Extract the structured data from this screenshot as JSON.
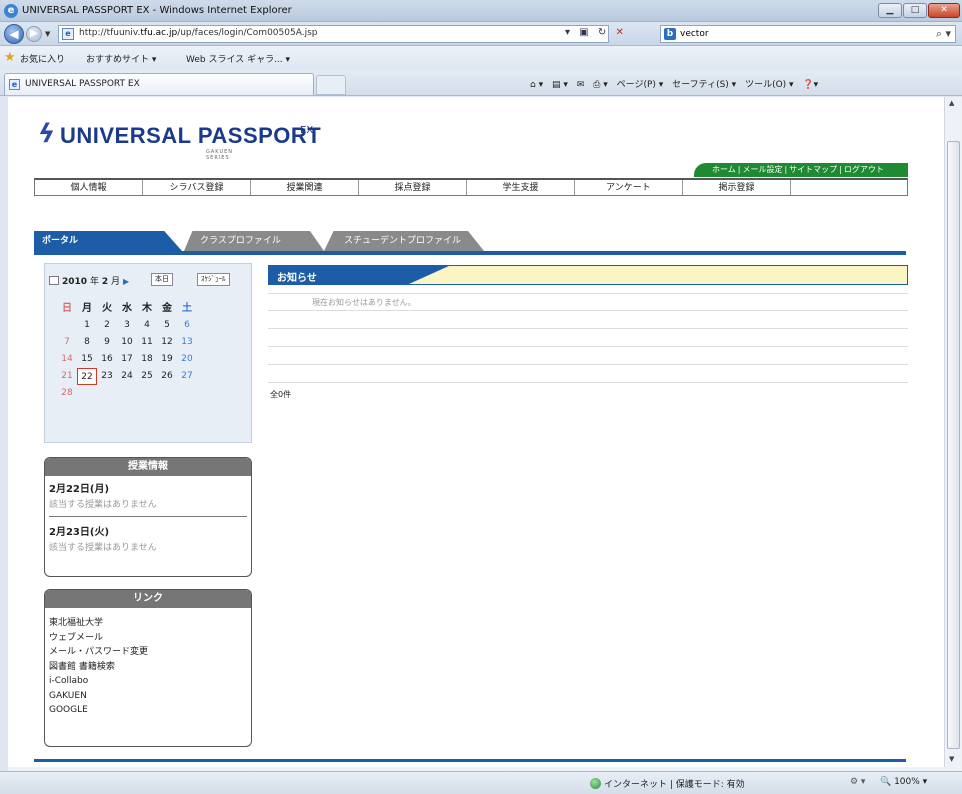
{
  "window": {
    "title": "UNIVERSAL PASSPORT EX - Windows Internet Explorer"
  },
  "address": {
    "url_prefix": "http://tfuuniv.",
    "url_host": "tfu.ac.jp",
    "url_path": "/up/faces/login/Com00505A.jsp",
    "search_value": "vector"
  },
  "favorites": {
    "label": "お気に入り",
    "suggested": "おすすめサイト ▾",
    "webslice": "Web スライス ギャラ... ▾"
  },
  "tab": {
    "label": "UNIVERSAL PASSPORT EX"
  },
  "commandbar": {
    "page": "ページ(P) ▾",
    "safety": "セーフティ(S) ▾",
    "tools": "ツール(O) ▾"
  },
  "brand": {
    "name": "UNIVERSAL PASSPORT",
    "suffix": "EX",
    "sub": "GAKUEN SERIES"
  },
  "util_links": [
    "ホーム",
    "メール設定",
    "サイトマップ",
    "ログアウト"
  ],
  "menu": [
    "個人情報",
    "シラバス登録",
    "授業関連",
    "採点登録",
    "学生支援",
    "アンケート",
    "掲示登録",
    ""
  ],
  "portal_tabs": [
    "ポータル",
    "クラスプロファイル",
    "スチューデントプロファイル"
  ],
  "calendar": {
    "year": "2010",
    "year_unit": "年",
    "month": "2",
    "month_unit": "月",
    "today_button": "本日",
    "schedule_button": "ｽｹｼﾞｭｰﾙ",
    "weekdays": [
      "日",
      "月",
      "火",
      "水",
      "木",
      "金",
      "土"
    ],
    "weeks": [
      [
        "",
        "1",
        "2",
        "3",
        "4",
        "5",
        "6"
      ],
      [
        "7",
        "8",
        "9",
        "10",
        "11",
        "12",
        "13"
      ],
      [
        "14",
        "15",
        "16",
        "17",
        "18",
        "19",
        "20"
      ],
      [
        "21",
        "22",
        "23",
        "24",
        "25",
        "26",
        "27"
      ],
      [
        "28",
        "",
        "",
        "",
        "",
        "",
        ""
      ]
    ],
    "today": "22"
  },
  "lessons": {
    "title": "授業情報",
    "days": [
      {
        "date": "2月22日(月)",
        "note": "該当する授業はありません"
      },
      {
        "date": "2月23日(火)",
        "note": "該当する授業はありません"
      }
    ]
  },
  "links": {
    "title": "リンク",
    "items": [
      "東北福祉大学",
      "ウェブメール",
      "メール・パスワード変更",
      "図書館 書籍検索",
      "i-Collabo",
      "GAKUEN",
      "GOOGLE"
    ]
  },
  "news": {
    "title": "お知らせ",
    "empty_message": "現在お知らせはありません。",
    "total": "全0件"
  },
  "status": {
    "zone": "インターネット | 保護モード: 有効",
    "zoom": "100%"
  }
}
